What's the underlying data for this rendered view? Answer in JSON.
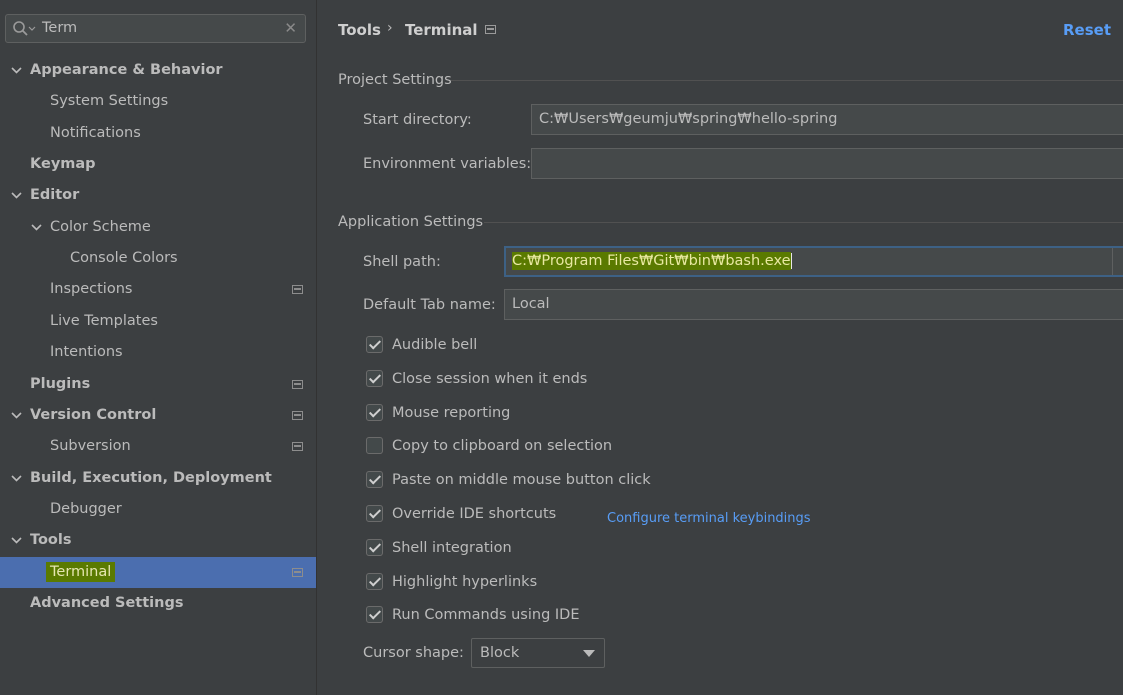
{
  "search": {
    "value": "Term"
  },
  "tree": [
    {
      "label": "Appearance & Behavior",
      "level": 0,
      "expanded": true,
      "bold": true,
      "page_icon": false,
      "selected": false
    },
    {
      "label": "System Settings",
      "level": 1,
      "expanded": null,
      "bold": false,
      "page_icon": false,
      "selected": false
    },
    {
      "label": "Notifications",
      "level": 1,
      "expanded": null,
      "bold": false,
      "page_icon": false,
      "selected": false
    },
    {
      "label": "Keymap",
      "level": 0,
      "expanded": null,
      "bold": true,
      "page_icon": false,
      "selected": false
    },
    {
      "label": "Editor",
      "level": 0,
      "expanded": true,
      "bold": true,
      "page_icon": false,
      "selected": false
    },
    {
      "label": "Color Scheme",
      "level": 1,
      "expanded": true,
      "bold": false,
      "page_icon": false,
      "selected": false
    },
    {
      "label": "Console Colors",
      "level": 2,
      "expanded": null,
      "bold": false,
      "page_icon": false,
      "selected": false
    },
    {
      "label": "Inspections",
      "level": 1,
      "expanded": null,
      "bold": false,
      "page_icon": true,
      "selected": false
    },
    {
      "label": "Live Templates",
      "level": 1,
      "expanded": null,
      "bold": false,
      "page_icon": false,
      "selected": false
    },
    {
      "label": "Intentions",
      "level": 1,
      "expanded": null,
      "bold": false,
      "page_icon": false,
      "selected": false
    },
    {
      "label": "Plugins",
      "level": 0,
      "expanded": null,
      "bold": true,
      "page_icon": true,
      "selected": false
    },
    {
      "label": "Version Control",
      "level": 0,
      "expanded": true,
      "bold": true,
      "page_icon": true,
      "selected": false
    },
    {
      "label": "Subversion",
      "level": 1,
      "expanded": null,
      "bold": false,
      "page_icon": true,
      "selected": false
    },
    {
      "label": "Build, Execution, Deployment",
      "level": 0,
      "expanded": true,
      "bold": true,
      "page_icon": false,
      "selected": false
    },
    {
      "label": "Debugger",
      "level": 1,
      "expanded": null,
      "bold": false,
      "page_icon": false,
      "selected": false
    },
    {
      "label": "Tools",
      "level": 0,
      "expanded": true,
      "bold": true,
      "page_icon": false,
      "selected": false
    },
    {
      "label": "Terminal",
      "level": 1,
      "expanded": null,
      "bold": false,
      "page_icon": true,
      "selected": true
    },
    {
      "label": "Advanced Settings",
      "level": 0,
      "expanded": null,
      "bold": true,
      "page_icon": false,
      "selected": false
    }
  ],
  "breadcrumb": {
    "parent": "Tools",
    "current": "Terminal"
  },
  "reset_label": "Reset",
  "project_settings": {
    "title": "Project Settings",
    "start_directory_label": "Start directory:",
    "start_directory_value": "C:₩Users₩geumju₩spring₩hello-spring",
    "env_label": "Environment variables:",
    "env_value": ""
  },
  "application_settings": {
    "title": "Application Settings",
    "shell_path_label": "Shell path:",
    "shell_path_value": "C:₩Program Files₩Git₩bin₩bash.exe",
    "tab_name_label": "Default Tab name:",
    "tab_name_value": "Local",
    "checkboxes": [
      {
        "label": "Audible bell",
        "checked": true
      },
      {
        "label": "Close session when it ends",
        "checked": true
      },
      {
        "label": "Mouse reporting",
        "checked": true
      },
      {
        "label": "Copy to clipboard on selection",
        "checked": false
      },
      {
        "label": "Paste on middle mouse button click",
        "checked": true
      },
      {
        "label": "Override IDE shortcuts",
        "checked": true
      },
      {
        "label": "Shell integration",
        "checked": true
      },
      {
        "label": "Highlight hyperlinks",
        "checked": true
      },
      {
        "label": "Run Commands using IDE",
        "checked": true
      }
    ],
    "keybindings_link": "Configure terminal keybindings",
    "cursor_shape_label": "Cursor shape:",
    "cursor_shape_value": "Block"
  },
  "colors": {
    "background": "#3c3f41",
    "selection": "#4b6eaf",
    "link": "#589df6",
    "search_highlight": "#5a7a00"
  }
}
